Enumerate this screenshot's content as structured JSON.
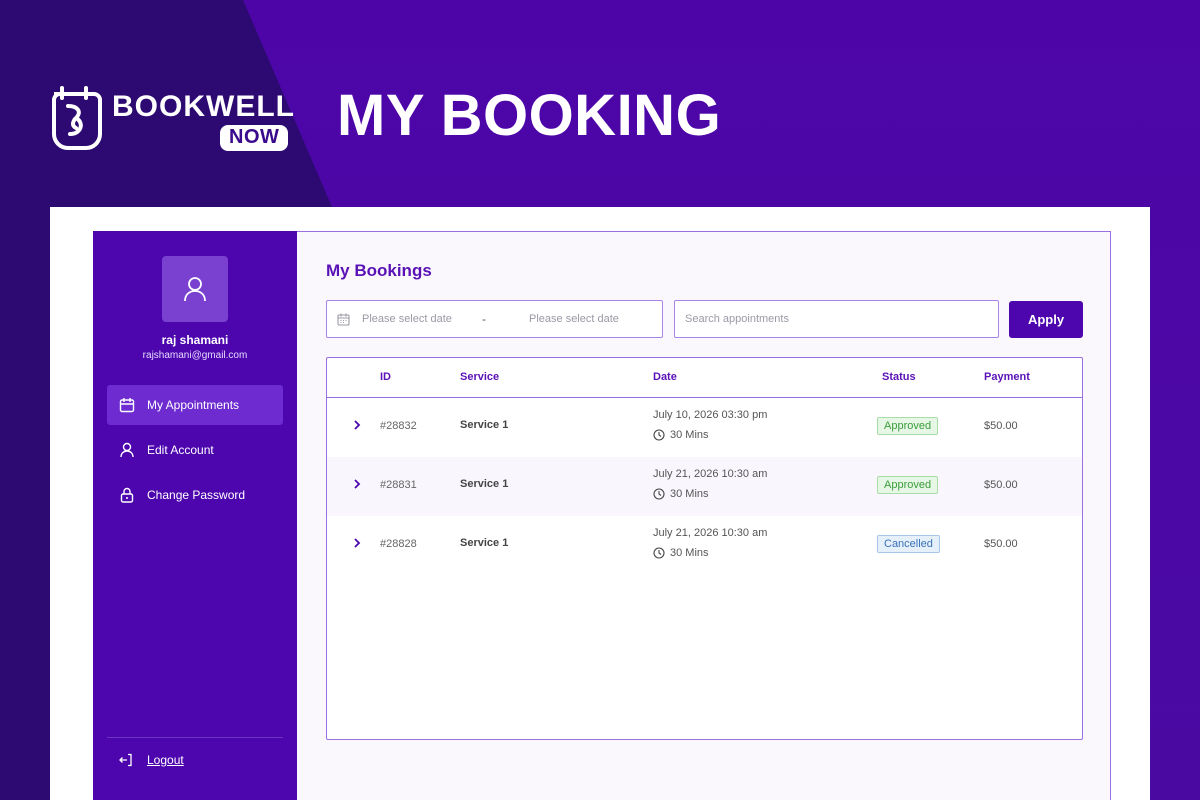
{
  "brand": {
    "name": "BOOKWELL",
    "badge": "NOW"
  },
  "heading": "MY BOOKING",
  "colors": {
    "brand_purple": "#4d06ae",
    "approved": "#3a9c3a",
    "cancelled": "#3a72b8"
  },
  "sidebar": {
    "user_name": "raj shamani",
    "user_email": "rajshamani@gmail.com",
    "items": [
      {
        "label": "My Appointments",
        "icon": "calendar-icon",
        "active": true
      },
      {
        "label": "Edit Account",
        "icon": "user-icon",
        "active": false
      },
      {
        "label": "Change Password",
        "icon": "lock-icon",
        "active": false
      }
    ],
    "logout_label": "Logout"
  },
  "main": {
    "title": "My Bookings",
    "date_from_placeholder": "Please select date",
    "date_separator": "-",
    "date_to_placeholder": "Please select date",
    "search_placeholder": "Search appointments",
    "apply_label": "Apply",
    "columns": [
      "ID",
      "Service",
      "Date",
      "Status",
      "Payment"
    ],
    "rows": [
      {
        "id": "#28832",
        "service": "Service 1",
        "date": "July 10, 2026 03:30 pm",
        "duration": "30 Mins",
        "status": "Approved",
        "payment": "$50.00"
      },
      {
        "id": "#28831",
        "service": "Service 1",
        "date": "July 21, 2026 10:30 am",
        "duration": "30 Mins",
        "status": "Approved",
        "payment": "$50.00"
      },
      {
        "id": "#28828",
        "service": "Service 1",
        "date": "July 21, 2026 10:30 am",
        "duration": "30 Mins",
        "status": "Cancelled",
        "payment": "$50.00"
      }
    ]
  }
}
